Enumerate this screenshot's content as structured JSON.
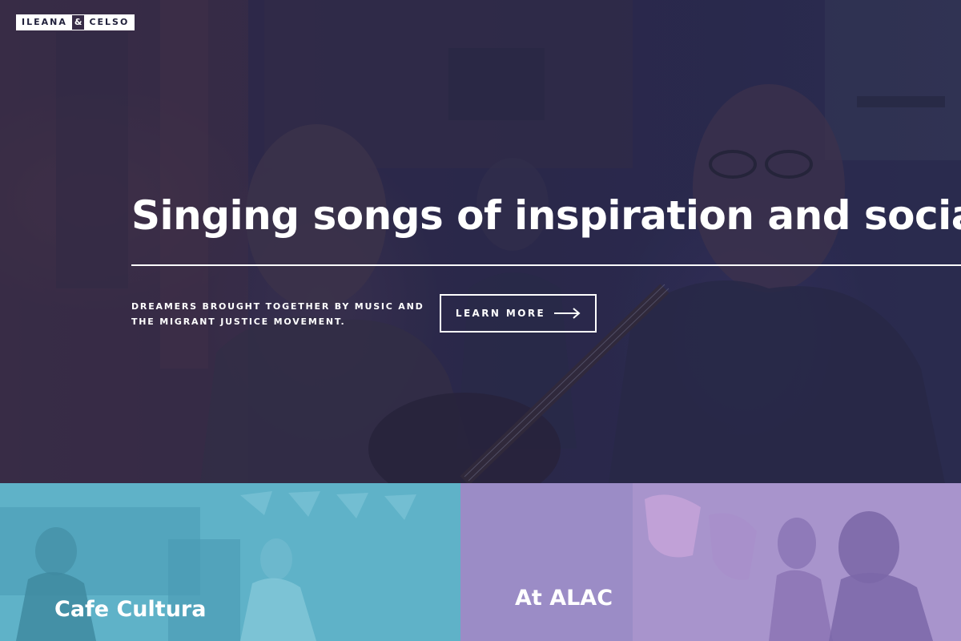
{
  "logo": {
    "first": "ILEANA",
    "amp": "&",
    "second": "CELSO"
  },
  "hero": {
    "headline": "Singing songs of inspiration and social justice",
    "tagline": "DREAMERS BROUGHT TOGETHER BY MUSIC AND THE MIGRANT JUSTICE MOVEMENT.",
    "cta_label": "LEARN MORE",
    "cta_icon": "arrow-right-icon"
  },
  "cards": [
    {
      "title": "Cafe Cultura",
      "color": "#5fb2c8"
    },
    {
      "title": "At ALAC",
      "color": "#9b8cc6"
    }
  ],
  "colors": {
    "hero_overlay": "#2a2a4e",
    "text": "#ffffff",
    "logo_text": "#1f1f3a"
  }
}
